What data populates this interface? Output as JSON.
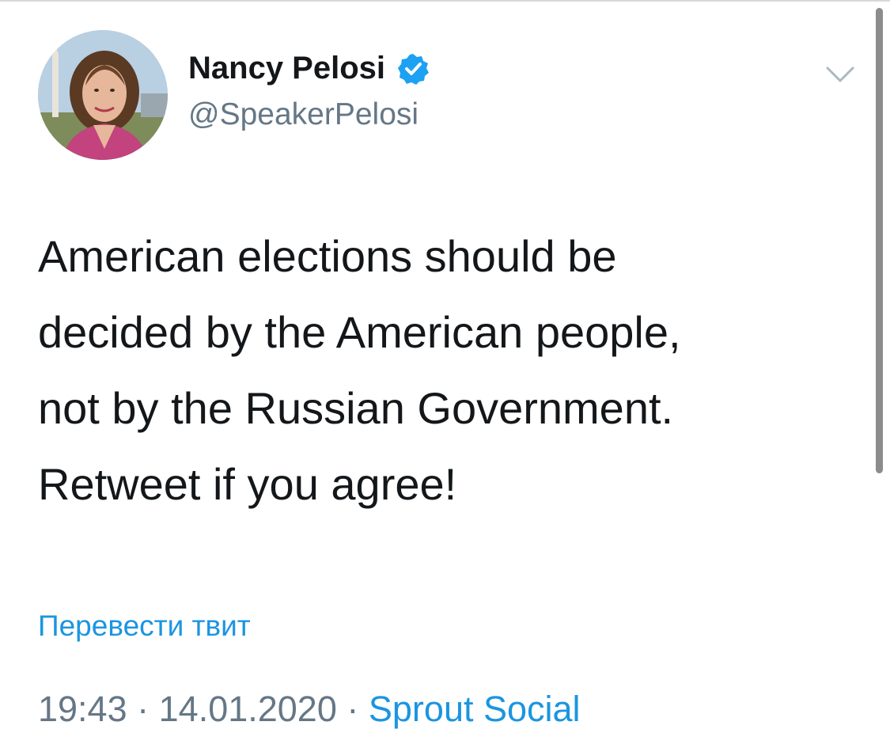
{
  "tweet": {
    "author": {
      "display_name": "Nancy Pelosi",
      "handle": "@SpeakerPelosi",
      "verified": true,
      "avatar": "profile-photo"
    },
    "text_lines": [
      "American elections should be",
      "decided by the American people,",
      "not by the Russian Government.",
      "Retweet if you agree!"
    ],
    "translate_label": "Перевести твит",
    "time": "19:43",
    "separator": "·",
    "date": "14.01.2020",
    "source": "Sprout Social"
  },
  "icons": {
    "verified": "verified-badge-icon",
    "more": "chevron-down-icon"
  },
  "colors": {
    "link": "#1b95e0",
    "secondary_text": "#657786",
    "primary_text": "#14171a",
    "verified_badge": "#1da1f2"
  }
}
